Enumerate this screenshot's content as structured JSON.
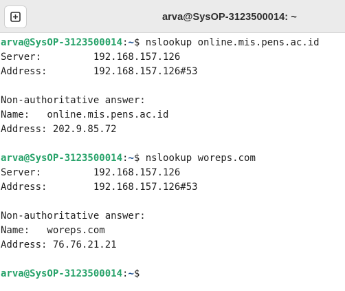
{
  "window": {
    "title": "arva@SysOP-3123500014: ~",
    "new_tab_icon": "plus-square-icon"
  },
  "terminal": {
    "prompt_user": "arva@SysOP-3123500014",
    "prompt_sep": ":",
    "prompt_path": "~",
    "prompt_symbol": "$ ",
    "lines": [
      {
        "type": "prompt",
        "command": "nslookup online.mis.pens.ac.id"
      },
      {
        "type": "text",
        "text": "Server:         192.168.157.126"
      },
      {
        "type": "text",
        "text": "Address:        192.168.157.126#53"
      },
      {
        "type": "text",
        "text": ""
      },
      {
        "type": "text",
        "text": "Non-authoritative answer:"
      },
      {
        "type": "text",
        "text": "Name:   online.mis.pens.ac.id"
      },
      {
        "type": "text",
        "text": "Address: 202.9.85.72"
      },
      {
        "type": "text",
        "text": ""
      },
      {
        "type": "prompt",
        "command": "nslookup woreps.com"
      },
      {
        "type": "text",
        "text": "Server:         192.168.157.126"
      },
      {
        "type": "text",
        "text": "Address:        192.168.157.126#53"
      },
      {
        "type": "text",
        "text": ""
      },
      {
        "type": "text",
        "text": "Non-authoritative answer:"
      },
      {
        "type": "text",
        "text": "Name:   woreps.com"
      },
      {
        "type": "text",
        "text": "Address: 76.76.21.21"
      },
      {
        "type": "text",
        "text": ""
      },
      {
        "type": "prompt",
        "command": ""
      }
    ]
  },
  "colors": {
    "prompt_user": "#26a269",
    "prompt_path": "#12488b",
    "text": "#1f1f1f",
    "titlebar": "#ebebeb"
  }
}
